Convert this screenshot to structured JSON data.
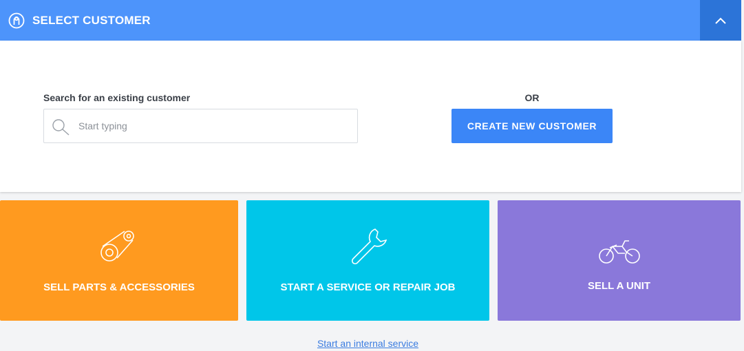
{
  "header": {
    "title": "SELECT CUSTOMER",
    "icon": "customer-icon",
    "collapse_icon": "chevron-up-icon"
  },
  "search": {
    "label": "Search for an existing customer",
    "placeholder": "Start typing",
    "value": "",
    "icon": "search-icon"
  },
  "or_label": "OR",
  "create_button": {
    "label": "CREATE NEW CUSTOMER"
  },
  "tiles": [
    {
      "label": "SELL PARTS & ACCESSORIES",
      "icon": "chain-sprocket-icon",
      "color": "#ff9a1f"
    },
    {
      "label": "START A SERVICE OR REPAIR JOB",
      "icon": "wrench-icon",
      "color": "#00c6e9"
    },
    {
      "label": "SELL A UNIT",
      "icon": "motorcycle-icon",
      "color": "#8a78da"
    }
  ],
  "internal_link": "Start an internal service",
  "colors": {
    "header": "#4d94fb",
    "header_button": "#2c74d8",
    "primary_button": "#3b86f7",
    "link": "#3a7ce0",
    "background": "#f3f4f6"
  }
}
